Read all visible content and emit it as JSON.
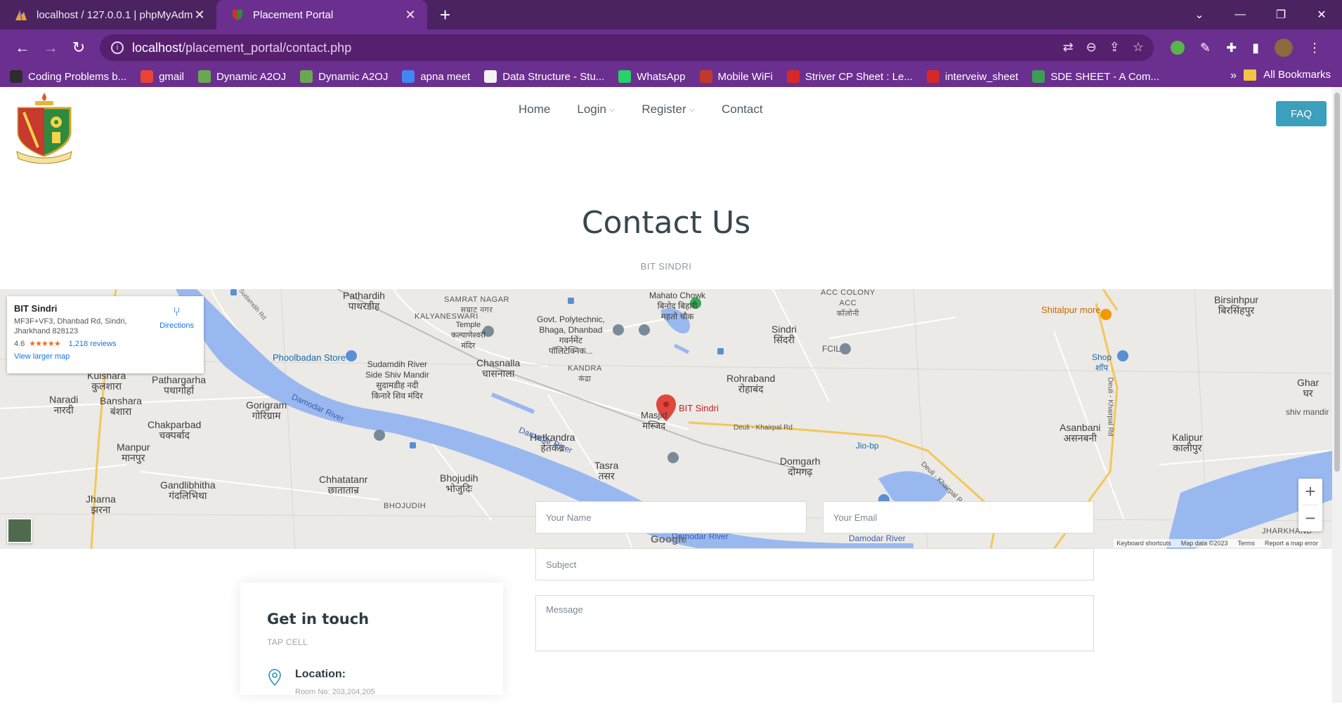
{
  "browser": {
    "tabs": [
      {
        "title": "localhost / 127.0.0.1 | phpMyAdmin",
        "active": false
      },
      {
        "title": "Placement Portal",
        "active": true
      }
    ],
    "url": {
      "host": "localhost",
      "path": "/placement_portal/contact.php"
    },
    "bookmarks": [
      {
        "label": "Coding Problems b...",
        "color": "#2d2d2d"
      },
      {
        "label": "gmail",
        "color": "#ea4335"
      },
      {
        "label": "Dynamic A2OJ",
        "color": "#6aa84f"
      },
      {
        "label": "Dynamic A2OJ",
        "color": "#6aa84f"
      },
      {
        "label": "apna meet",
        "color": "#4285f4"
      },
      {
        "label": "Data Structure - Stu...",
        "color": "#f2f2f2"
      },
      {
        "label": "WhatsApp",
        "color": "#25d366"
      },
      {
        "label": "Mobile WiFi",
        "color": "#c0392b"
      },
      {
        "label": "Striver CP Sheet : Le...",
        "color": "#d62828"
      },
      {
        "label": "interveiw_sheet",
        "color": "#d62828"
      },
      {
        "label": "SDE SHEET - A Com...",
        "color": "#3c9e55"
      }
    ],
    "all_bookmarks": "All Bookmarks"
  },
  "site": {
    "nav": [
      {
        "label": "Home",
        "caret": false
      },
      {
        "label": "Login",
        "caret": true
      },
      {
        "label": "Register",
        "caret": true
      },
      {
        "label": "Contact",
        "caret": false
      }
    ],
    "faq_label": "FAQ",
    "title": "Contact Us",
    "subtitle": "BIT SINDRI"
  },
  "map": {
    "card": {
      "name": "BIT Sindri",
      "address": "MF3F+VF3, Dhanbad Rd, Sindri, Jharkhand 828123",
      "rating": "4.6",
      "stars": "★★★★★",
      "reviews": "1,218 reviews",
      "larger_map": "View larger map",
      "directions": "Directions"
    },
    "marker_label": "BIT Sindri",
    "labels": {
      "pathardih": "Pathardih\nपाथरडीह",
      "samrat": "SAMRAT NAGAR\nसम्राट नगर",
      "kalyaneswari": "KALYANESWARI",
      "temple": "Temple\nकल्याणेश्वरी\nमंदिर",
      "govt_poly": "Govt. Polytechnic,\nBhaga, Dhanbad\nगवर्नमेंट\nपॉलिटेक्निक...",
      "mahato": "Mahato Chowk\nबिनोद बिहारी\nमहतो चौक",
      "acc": "ACC COLONY\nACC\nकॉलोनी",
      "birsinhpur": "Birsinhpur\nबिरसिंहपुर",
      "shitalpur": "Shitalpur more",
      "sindri": "Sindri\nसिंदरी",
      "fcil": "FCIL",
      "shop": "Shop\nशॉप",
      "phoolbadan": "Phoolbadan Store",
      "sudamdih": "Sudamdih River\nSide Shiv Mandir\nसुदामडीह नदी\nकिनारे शिव मंदिर",
      "chasnalla": "Chasnalla\nचासनाला",
      "kandra": "KANDRA\nकंद्रा",
      "rohraband": "Rohraband\nरोहाबंद",
      "kulshara": "Kulshara\nकुलशारा",
      "pathargarha": "Pathargarha\nपथागोर्हा",
      "naradi": "Naradi\nनारदी",
      "banshara": "Banshara\nबंशारा",
      "gorigram": "Gorigram\nगोरिग्राम",
      "damodar": "Damodar River",
      "chakparbad": "Chakparbad\nचक्पर्बाद",
      "hetkandra": "Hetkandra\nहेतकंद्र",
      "masjid": "Masjid\nमस्जिद",
      "deuli": "Deuli - Khairpal Rd",
      "jiobp": "Jio-bp",
      "asanbani": "Asanbani\nअसनबनी",
      "kalipur": "Kalipur\nकालीपुर",
      "ghar": "Ghar\nघर",
      "shiv_mandir": "shiv mandir",
      "manpur": "Manpur\nमानपुर",
      "tasra": "Tasra\nतसर",
      "domgarh": "Domgarh\nदोमगढ़",
      "gandlibhitha": "Gandlibhitha\nगंदलिभिथा",
      "chhatatanr": "Chhatatanr\nछातातान्र",
      "bhojudih": "Bhojudih\nभोजुदिः",
      "bhojudih_caps": "BHOJUDIH",
      "jharna": "Jharna\nझरना",
      "sudamdih_rd": "Sudamdih Rd",
      "khairpal_vert": "Deuli - Khairpal Rd",
      "jharkhand": "JHARKHAND"
    },
    "google": "Google",
    "attribution": [
      "Keyboard shortcuts",
      "Map data ©2023",
      "Terms",
      "Report a map error"
    ]
  },
  "contact": {
    "heading": "Get in touch",
    "subheading": "TAP CELL",
    "location_label": "Location:",
    "location_text": "Room No: 203,204,205"
  },
  "form": {
    "name_placeholder": "Your Name",
    "email_placeholder": "Your Email",
    "subject_placeholder": "Subject",
    "message_placeholder": "Message"
  }
}
